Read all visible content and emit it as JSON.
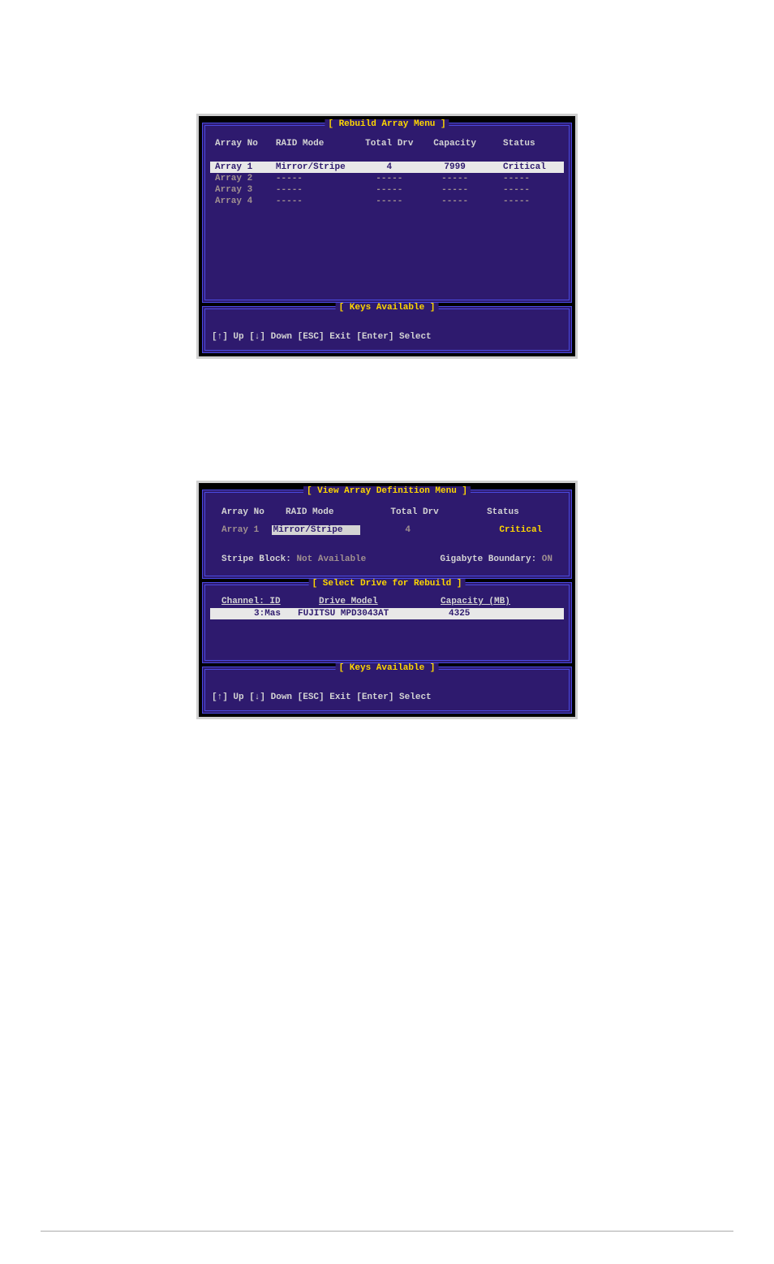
{
  "screen1": {
    "title": "[ Rebuild Array Menu ]",
    "headers": {
      "arrayno": "Array No",
      "raid": "RAID Mode",
      "totaldrv": "Total Drv",
      "capacity": "Capacity",
      "status": "Status"
    },
    "rows": [
      {
        "arrayno": "Array  1",
        "raid": "Mirror/Stripe",
        "totaldrv": "4",
        "capacity": "7999",
        "status": "Critical",
        "selected": true
      },
      {
        "arrayno": "Array  2",
        "raid": "-----",
        "totaldrv": "-----",
        "capacity": "-----",
        "status": "-----",
        "selected": false
      },
      {
        "arrayno": "Array  3",
        "raid": "-----",
        "totaldrv": "-----",
        "capacity": "-----",
        "status": "-----",
        "selected": false
      },
      {
        "arrayno": "Array  4",
        "raid": "-----",
        "totaldrv": "-----",
        "capacity": "-----",
        "status": "-----",
        "selected": false
      }
    ],
    "keys": {
      "title": "[ Keys Available ]",
      "line": "[↑] Up  [↓] Down  [ESC] Exit  [Enter] Select"
    }
  },
  "screen2": {
    "title": "[ View Array Definition Menu ]",
    "headers": {
      "arrayno": "Array No",
      "raid": "RAID Mode",
      "totaldrv": "Total Drv",
      "status": "Status"
    },
    "datarow": {
      "arrayno": "Array  1",
      "raid": "Mirror/Stripe",
      "totaldrv": "4",
      "status": "Critical"
    },
    "stripe": {
      "label": "Stripe Block:",
      "value": "Not Available",
      "gblabel": "Gigabyte Boundary:",
      "gbvalue": "ON"
    },
    "subtitle": "[ Select Drive for Rebuild ]",
    "driveheaders": {
      "channel": "Channel: ID",
      "model": "Drive Model",
      "capacity": "Capacity (MB)"
    },
    "driverow": {
      "channel": "3:Mas",
      "model": "FUJITSU MPD3043AT",
      "capacity": "4325"
    },
    "keys": {
      "title": "[ Keys Available ]",
      "line": "[↑] Up  [↓] Down  [ESC] Exit  [Enter] Select"
    }
  }
}
